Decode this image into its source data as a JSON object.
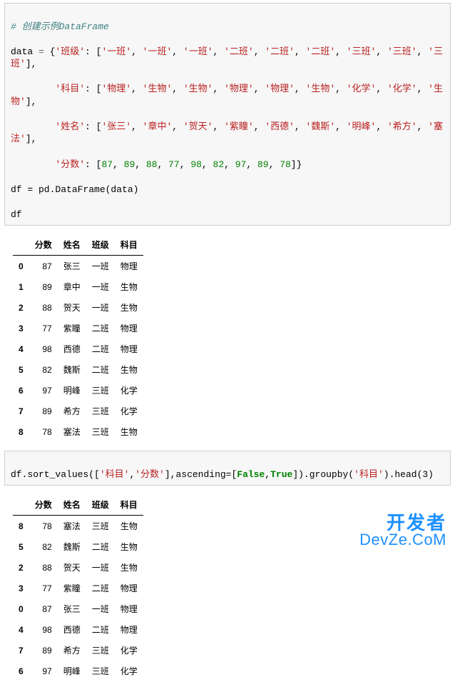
{
  "code1": {
    "comment": "# 创建示例DataFrame",
    "line1_pre": "data = {",
    "key1": "'班级'",
    "vals1": [
      "'一班'",
      "'一班'",
      "'一班'",
      "'二班'",
      "'二班'",
      "'二班'",
      "'三班'",
      "'三班'",
      "'三班'"
    ],
    "key2": "'科目'",
    "vals2": [
      "'物理'",
      "'生物'",
      "'生物'",
      "'物理'",
      "'物理'",
      "'生物'",
      "'化学'",
      "'化学'",
      "'生物'"
    ],
    "key3": "'姓名'",
    "vals3": [
      "'张三'",
      "'章中'",
      "'贺天'",
      "'紫瞳'",
      "'西德'",
      "'魏斯'",
      "'明峰'",
      "'希方'",
      "'塞法'"
    ],
    "key4": "'分数'",
    "vals4": [
      "87",
      "89",
      "88",
      "77",
      "98",
      "82",
      "97",
      "89",
      "78"
    ],
    "line5": "df = pd.DataFrame(data)",
    "line6": "df"
  },
  "table1": {
    "columns": [
      "分数",
      "姓名",
      "班级",
      "科目"
    ],
    "rows": [
      {
        "idx": "0",
        "分数": "87",
        "姓名": "张三",
        "班级": "一班",
        "科目": "物理"
      },
      {
        "idx": "1",
        "分数": "89",
        "姓名": "章中",
        "班级": "一班",
        "科目": "生物"
      },
      {
        "idx": "2",
        "分数": "88",
        "姓名": "贺天",
        "班级": "一班",
        "科目": "生物"
      },
      {
        "idx": "3",
        "分数": "77",
        "姓名": "紫瞳",
        "班级": "二班",
        "科目": "物理"
      },
      {
        "idx": "4",
        "分数": "98",
        "姓名": "西德",
        "班级": "二班",
        "科目": "物理"
      },
      {
        "idx": "5",
        "分数": "82",
        "姓名": "魏斯",
        "班级": "二班",
        "科目": "生物"
      },
      {
        "idx": "6",
        "分数": "97",
        "姓名": "明峰",
        "班级": "三班",
        "科目": "化学"
      },
      {
        "idx": "7",
        "分数": "89",
        "姓名": "希方",
        "班级": "三班",
        "科目": "化学"
      },
      {
        "idx": "8",
        "分数": "78",
        "姓名": "塞法",
        "班级": "三班",
        "科目": "生物"
      }
    ]
  },
  "code2": {
    "pre": "df.sort_values([",
    "arg1": "'科目'",
    "comma1": ",",
    "arg2": "'分数'",
    "mid": "],ascending=[",
    "bool1": "False",
    "comma2": ",",
    "bool2": "True",
    "post1": "]).groupby(",
    "arg3": "'科目'",
    "post2": ").head(3)"
  },
  "table2": {
    "columns": [
      "分数",
      "姓名",
      "班级",
      "科目"
    ],
    "rows": [
      {
        "idx": "8",
        "分数": "78",
        "姓名": "塞法",
        "班级": "三班",
        "科目": "生物"
      },
      {
        "idx": "5",
        "分数": "82",
        "姓名": "魏斯",
        "班级": "二班",
        "科目": "生物"
      },
      {
        "idx": "2",
        "分数": "88",
        "姓名": "贺天",
        "班级": "一班",
        "科目": "生物"
      },
      {
        "idx": "3",
        "分数": "77",
        "姓名": "紫瞳",
        "班级": "二班",
        "科目": "物理"
      },
      {
        "idx": "0",
        "分数": "87",
        "姓名": "张三",
        "班级": "一班",
        "科目": "物理"
      },
      {
        "idx": "4",
        "分数": "98",
        "姓名": "西德",
        "班级": "二班",
        "科目": "物理"
      },
      {
        "idx": "7",
        "分数": "89",
        "姓名": "希方",
        "班级": "三班",
        "科目": "化学"
      },
      {
        "idx": "6",
        "分数": "97",
        "姓名": "明峰",
        "班级": "三班",
        "科目": "化学"
      }
    ]
  },
  "watermark": {
    "top": "开发者",
    "bot_parts": [
      "D",
      "ev",
      "Z",
      "e",
      ".C",
      "o",
      "M"
    ]
  }
}
